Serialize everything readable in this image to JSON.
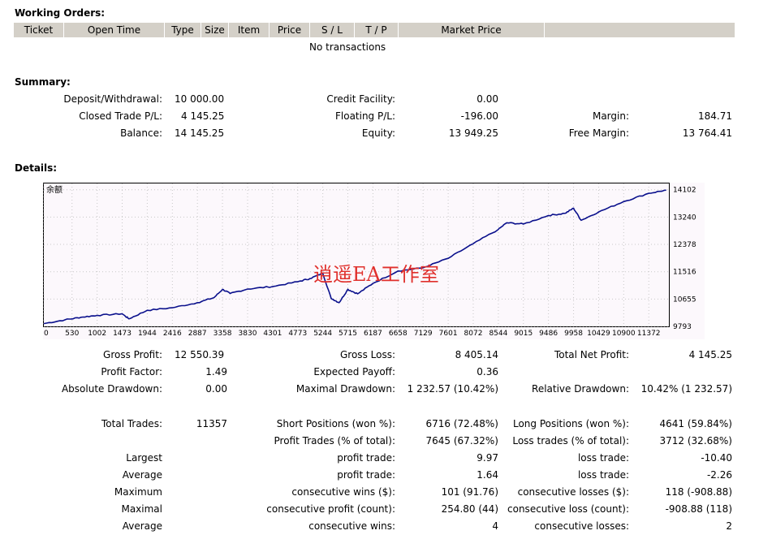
{
  "working_orders": {
    "title": "Working Orders:",
    "columns": [
      "Ticket",
      "Open Time",
      "Type",
      "Size",
      "Item",
      "Price",
      "S / L",
      "T / P",
      "Market Price",
      ""
    ],
    "empty_text": "No transactions"
  },
  "summary": {
    "title": "Summary:",
    "deposit_label": "Deposit/Withdrawal:",
    "deposit_value": "10 000.00",
    "credit_label": "Credit Facility:",
    "credit_value": "0.00",
    "closed_pl_label": "Closed Trade P/L:",
    "closed_pl_value": "4 145.25",
    "floating_pl_label": "Floating P/L:",
    "floating_pl_value": "-196.00",
    "margin_label": "Margin:",
    "margin_value": "184.71",
    "balance_label": "Balance:",
    "balance_value": "14 145.25",
    "equity_label": "Equity:",
    "equity_value": "13 949.25",
    "free_margin_label": "Free Margin:",
    "free_margin_value": "13 764.41"
  },
  "details": {
    "title": "Details:",
    "chart_legend": "余额",
    "watermark": "逍遥EA工作室"
  },
  "chart_data": {
    "type": "line",
    "title": "",
    "legend": "余额",
    "x_ticks": [
      0,
      530,
      1002,
      1473,
      1944,
      2416,
      2887,
      3358,
      3830,
      4301,
      4773,
      5244,
      5715,
      6187,
      6658,
      7129,
      7601,
      8072,
      8544,
      9015,
      9486,
      9958,
      10429,
      10900,
      11372
    ],
    "y_ticks": [
      9793,
      10655,
      11516,
      12378,
      13240,
      14102
    ],
    "xlim": [
      0,
      11750
    ],
    "ylim": [
      9793,
      14300
    ],
    "grid": true,
    "series": [
      {
        "name": "余额",
        "x": [
          0,
          400,
          700,
          1000,
          1473,
          1600,
          1944,
          2416,
          2887,
          3200,
          3358,
          3500,
          3830,
          4301,
          4773,
          5000,
          5244,
          5400,
          5550,
          5715,
          5900,
          6187,
          6658,
          7129,
          7601,
          8072,
          8544,
          8700,
          9015,
          9486,
          9800,
          9958,
          10100,
          10429,
          10900,
          11372,
          11700
        ],
        "y": [
          9880,
          10000,
          10080,
          10140,
          10190,
          10030,
          10300,
          10380,
          10540,
          10700,
          10960,
          10830,
          10970,
          11050,
          11200,
          11300,
          11470,
          10680,
          10540,
          10960,
          10820,
          11150,
          11540,
          11640,
          11940,
          12400,
          12850,
          13060,
          13020,
          13290,
          13360,
          13520,
          13140,
          13400,
          13730,
          13990,
          14090
        ]
      }
    ]
  },
  "stats": {
    "gross_profit_label": "Gross Profit:",
    "gross_profit_value": "12 550.39",
    "gross_loss_label": "Gross Loss:",
    "gross_loss_value": "8 405.14",
    "total_net_profit_label": "Total Net Profit:",
    "total_net_profit_value": "4 145.25",
    "profit_factor_label": "Profit Factor:",
    "profit_factor_value": "1.49",
    "expected_payoff_label": "Expected Payoff:",
    "expected_payoff_value": "0.36",
    "absolute_drawdown_label": "Absolute Drawdown:",
    "absolute_drawdown_value": "0.00",
    "maximal_drawdown_label": "Maximal Drawdown:",
    "maximal_drawdown_value": "1 232.57 (10.42%)",
    "relative_drawdown_label": "Relative Drawdown:",
    "relative_drawdown_value": "10.42% (1 232.57)",
    "total_trades_label": "Total Trades:",
    "total_trades_value": "11357",
    "short_positions_label": "Short Positions (won %):",
    "short_positions_value": "6716 (72.48%)",
    "long_positions_label": "Long Positions (won %):",
    "long_positions_value": "4641 (59.84%)",
    "profit_trades_label": "Profit Trades (% of total):",
    "profit_trades_value": "7645 (67.32%)",
    "loss_trades_label": "Loss trades (% of total):",
    "loss_trades_value": "3712 (32.68%)",
    "largest_label": "Largest",
    "largest_profit_label": "profit trade:",
    "largest_profit_value": "9.97",
    "largest_loss_label": "loss trade:",
    "largest_loss_value": "-10.40",
    "average_label": "Average",
    "average_profit_label": "profit trade:",
    "average_profit_value": "1.64",
    "average_loss_label": "loss trade:",
    "average_loss_value": "-2.26",
    "maximum_label": "Maximum",
    "max_cons_wins_label": "consecutive wins ($):",
    "max_cons_wins_value": "101 (91.76)",
    "max_cons_losses_label": "consecutive losses ($):",
    "max_cons_losses_value": "118 (-908.88)",
    "maximal_label": "Maximal",
    "maximal_cons_profit_label": "consecutive profit (count):",
    "maximal_cons_profit_value": "254.80 (44)",
    "maximal_cons_loss_label": "consecutive loss (count):",
    "maximal_cons_loss_value": "-908.88 (118)",
    "average2_label": "Average",
    "avg_cons_wins_label": "consecutive wins:",
    "avg_cons_wins_value": "4",
    "avg_cons_losses_label": "consecutive losses:",
    "avg_cons_losses_value": "2"
  }
}
